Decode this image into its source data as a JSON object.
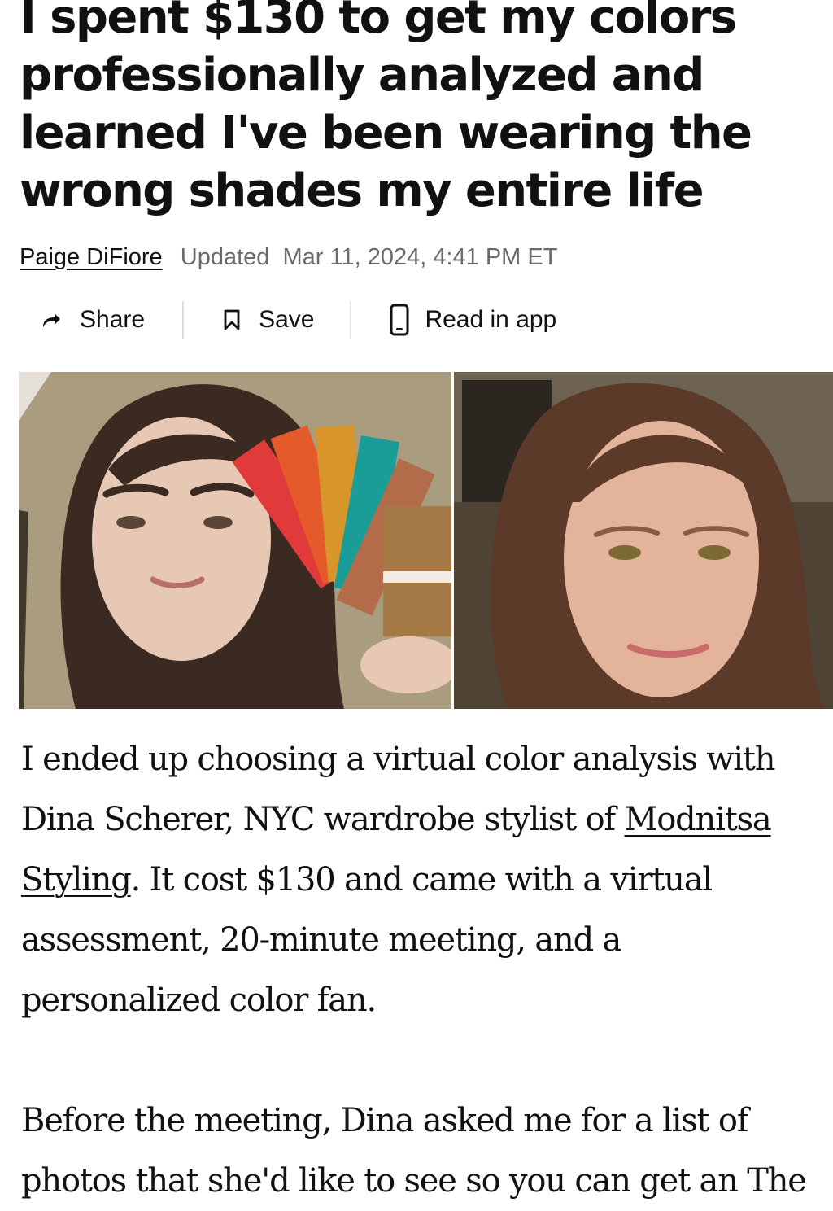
{
  "article": {
    "headline": "I spent $130 to get my colors professionally analyzed and learned I've been wearing the wrong shades my entire life",
    "author": "Paige DiFiore",
    "updated_label": "Updated",
    "updated_date": "Mar 11, 2024, 4:41 PM ET"
  },
  "actions": {
    "share_label": "Share",
    "save_label": "Save",
    "app_label": "Read in app"
  },
  "body": {
    "p1_before_link": "I ended up choosing a virtual color analysis with Dina Scherer, NYC wardrobe stylist of ",
    "p1_link": "Modnitsa Styling",
    "p1_after_link": ". It cost $130 and came with a virtual assessment, 20-minute meeting, and a personalized color fan.",
    "p2": "Before the meeting, Dina asked me for a list of photos that she'd like to see so you can get an The"
  },
  "colors": {
    "text": "#111111",
    "meta_gray": "#6b6b6b",
    "divider": "#dcdcdc"
  },
  "icons": {
    "share": "share-arrow-icon",
    "save": "bookmark-icon",
    "app": "phone-icon"
  }
}
